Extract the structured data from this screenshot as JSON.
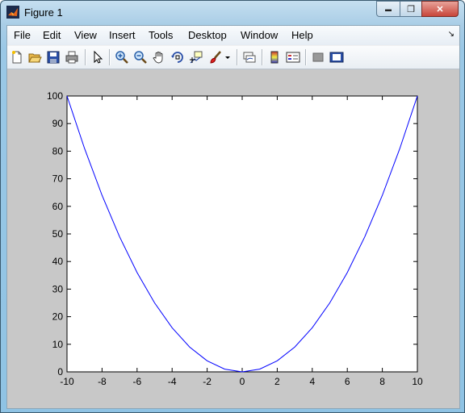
{
  "window": {
    "title": "Figure 1",
    "controls": {
      "minimize": "▬",
      "maximize": "❐",
      "close": "✕"
    }
  },
  "menubar": {
    "items": [
      "File",
      "Edit",
      "View",
      "Insert",
      "Tools",
      "Desktop",
      "Window",
      "Help"
    ],
    "overflow_glyph": "↘"
  },
  "toolbar": {
    "buttons": [
      {
        "name": "new-figure-icon"
      },
      {
        "name": "open-file-icon"
      },
      {
        "name": "save-figure-icon"
      },
      {
        "name": "print-figure-icon"
      },
      {
        "name": "edit-plot-arrow-icon"
      },
      {
        "name": "zoom-in-icon"
      },
      {
        "name": "zoom-out-icon"
      },
      {
        "name": "pan-hand-icon"
      },
      {
        "name": "rotate-3d-icon"
      },
      {
        "name": "data-cursor-icon"
      },
      {
        "name": "brush-icon"
      },
      {
        "name": "brush-dropdown-icon"
      },
      {
        "name": "link-plot-icon"
      },
      {
        "name": "insert-colorbar-icon"
      },
      {
        "name": "insert-legend-icon"
      },
      {
        "name": "hide-plot-tools-icon"
      },
      {
        "name": "show-plot-tools-icon"
      }
    ]
  },
  "colors": {
    "line": "#0000ff",
    "figure_bg": "#c8c8c8",
    "axes_bg": "#ffffff"
  },
  "chart_data": {
    "type": "line",
    "title": "",
    "xlabel": "",
    "ylabel": "",
    "xlim": [
      -10,
      10
    ],
    "ylim": [
      0,
      100
    ],
    "xticks": [
      -10,
      -8,
      -6,
      -4,
      -2,
      0,
      2,
      4,
      6,
      8,
      10
    ],
    "yticks": [
      0,
      10,
      20,
      30,
      40,
      50,
      60,
      70,
      80,
      90,
      100
    ],
    "grid": false,
    "series": [
      {
        "x": [
          -10,
          -9,
          -8,
          -7,
          -6,
          -5,
          -4,
          -3,
          -2,
          -1,
          0,
          1,
          2,
          3,
          4,
          5,
          6,
          7,
          8,
          9,
          10
        ],
        "y": [
          100,
          81,
          64,
          49,
          36,
          25,
          16,
          9,
          4,
          1,
          0,
          1,
          4,
          9,
          16,
          25,
          36,
          49,
          64,
          81,
          100
        ]
      }
    ]
  }
}
